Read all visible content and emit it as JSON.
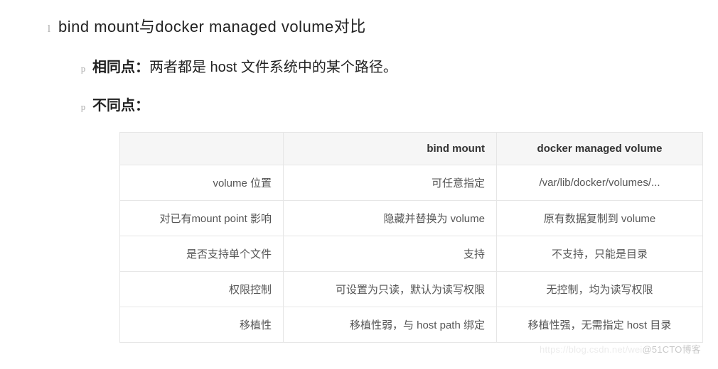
{
  "markers": {
    "l": "l",
    "p": "p"
  },
  "title": {
    "text": "bind mount与docker managed volume对比"
  },
  "points": {
    "same_label": "相同点：",
    "same_text": "两者都是 host 文件系统中的某个路径。",
    "diff_label": "不同点："
  },
  "table": {
    "header": {
      "blank": "",
      "bind": "bind mount",
      "managed": "docker managed volume"
    },
    "rows": [
      {
        "attr": "volume 位置",
        "bind": "可任意指定",
        "managed": "/var/lib/docker/volumes/..."
      },
      {
        "attr": "对已有mount point 影响",
        "bind": "隐藏并替换为 volume",
        "managed": "原有数据复制到 volume"
      },
      {
        "attr": "是否支持单个文件",
        "bind": "支持",
        "managed": "不支持，只能是目录"
      },
      {
        "attr": "权限控制",
        "bind": "可设置为只读，默认为读写权限",
        "managed": "无控制，均为读写权限"
      },
      {
        "attr": "移植性",
        "bind": "移植性弱，与 host path 绑定",
        "managed": "移植性强，无需指定 host 目录"
      }
    ]
  },
  "watermark": {
    "faint": "https://blog.csdn.net/wei",
    "visible": "@51CTO博客"
  }
}
